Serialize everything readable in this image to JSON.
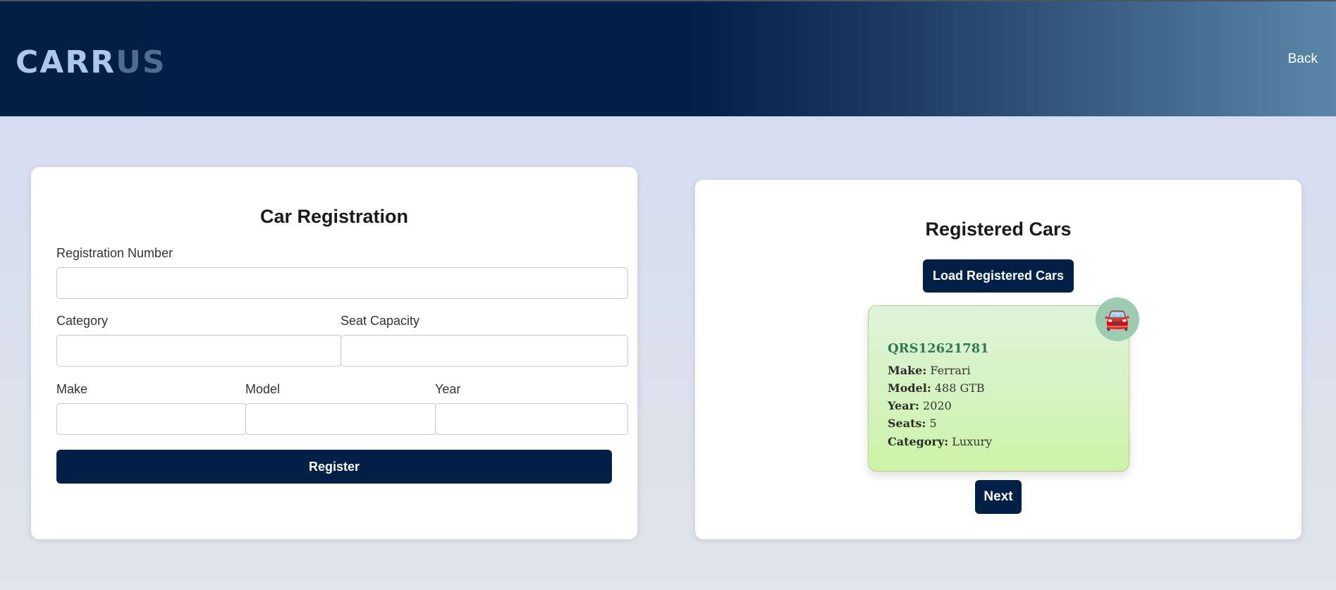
{
  "header": {
    "logo_part1": "CARR",
    "logo_part2": "US",
    "back_label": "Back"
  },
  "registration": {
    "title": "Car Registration",
    "reg_number_label": "Registration Number",
    "reg_number_value": "",
    "category_label": "Category",
    "category_value": "",
    "seat_label": "Seat Capacity",
    "seat_value": "",
    "make_label": "Make",
    "make_value": "",
    "model_label": "Model",
    "model_value": "",
    "year_label": "Year",
    "year_value": "",
    "register_label": "Register"
  },
  "registered": {
    "title": "Registered Cars",
    "load_label": "Load Registered Cars",
    "next_label": "Next",
    "car_icon": "car-icon",
    "car": {
      "reg_number": "QRS12621781",
      "make_label": "Make:",
      "make": "Ferrari",
      "model_label": "Model:",
      "model": "488 GTB",
      "year_label": "Year:",
      "year": "2020",
      "seats_label": "Seats:",
      "seats": "5",
      "category_label": "Category:",
      "category": "Luxury"
    }
  },
  "colors": {
    "primary": "#032147",
    "logo_light": "#a9c8ec",
    "logo_dark": "#4f6d90",
    "reg_number": "#2e7a55"
  }
}
